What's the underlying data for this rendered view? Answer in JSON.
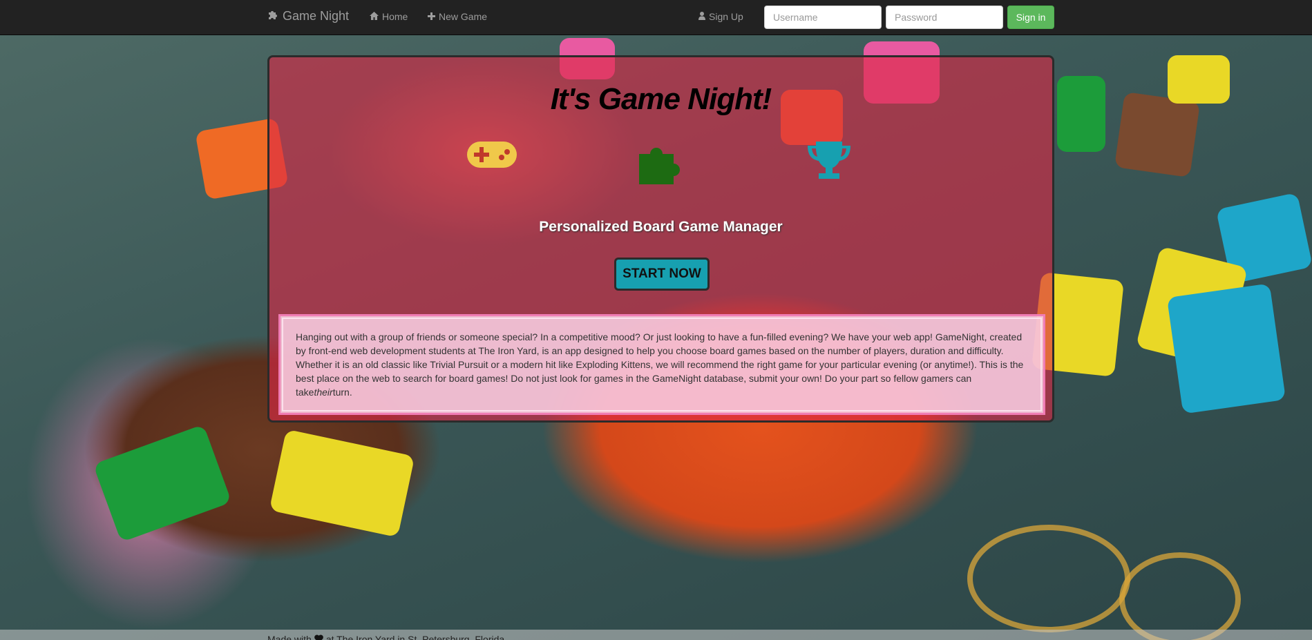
{
  "navbar": {
    "brand": "Game Night",
    "home": "Home",
    "new_game": "New Game",
    "sign_up": "Sign Up",
    "username_placeholder": "Username",
    "password_placeholder": "Password",
    "sign_in": "Sign in",
    "icons": [
      "puzzle-icon",
      "home-icon",
      "plus-icon",
      "user-icon"
    ]
  },
  "hero": {
    "title": "It's Game Night!",
    "features": [
      {
        "icon": "gamepad-icon",
        "color": "#f0c84a"
      },
      {
        "icon": "puzzle-icon",
        "color": "#1d6b12"
      },
      {
        "icon": "trophy-icon",
        "color": "#17a0b0"
      }
    ],
    "subtitle": "Personalized Board Game Manager",
    "cta": "START NOW",
    "about_before": "Hanging out with a group of friends or someone special? In a competitive mood? Or just looking to have a fun-filled evening? We have your web app! GameNight, created by front-end web development students at The Iron Yard, is an app designed to help you choose board games based on the number of players, duration and difficulty. Whether it is an old classic like Trivial Pursuit or a modern hit like Exploding Kittens, we will recommend the right game for your particular evening (or anytime!). This is the best place on the web to search for board games! Do not just look for games in the GameNight database, submit your own! Do your part so fellow gamers can take",
    "about_em": "their",
    "about_after": "turn."
  },
  "footer": {
    "before": "Made with",
    "icon": "heart-icon",
    "after": "at The Iron Yard in St. Petersburg, Florida"
  },
  "colors": {
    "navbar": "#222222",
    "signin": "#5cb85c",
    "hero_overlay": "#dc2846",
    "cta": "#17a0b0"
  }
}
